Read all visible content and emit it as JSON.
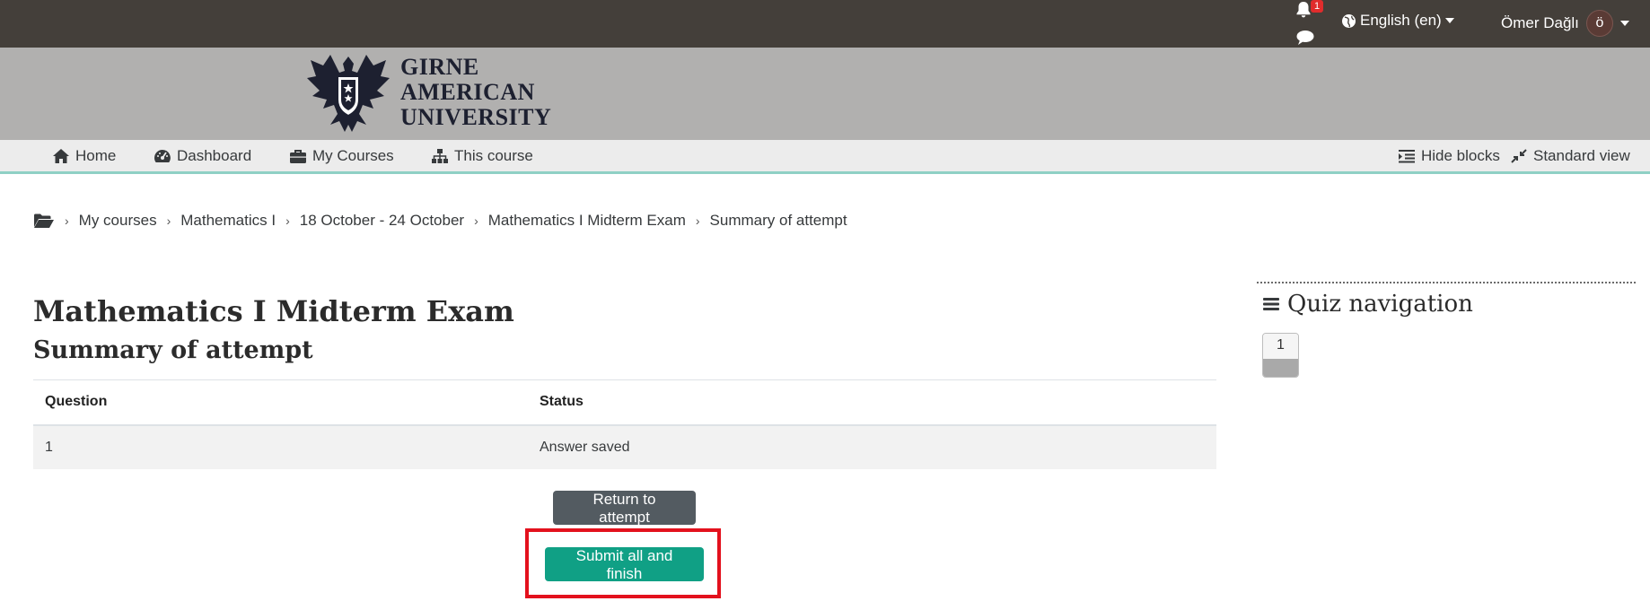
{
  "topbar": {
    "notifications_count": "1",
    "language_label": "English (en)",
    "user_name": "Ömer Dağlı",
    "avatar_initial": "ö"
  },
  "banner": {
    "logo_line1": "GIRNE",
    "logo_line2": "AMERICAN",
    "logo_line3": "UNIVERSITY"
  },
  "nav": {
    "home": "Home",
    "dashboard": "Dashboard",
    "my_courses": "My Courses",
    "this_course": "This course",
    "hide_blocks": "Hide blocks",
    "standard_view": "Standard view"
  },
  "breadcrumb": {
    "items": [
      "My courses",
      "Mathematics I",
      "18 October - 24 October",
      "Mathematics I Midterm Exam",
      "Summary of attempt"
    ]
  },
  "main": {
    "title": "Mathematics I Midterm Exam",
    "subtitle": "Summary of attempt",
    "table": {
      "headers": [
        "Question",
        "Status"
      ],
      "rows": [
        [
          "1",
          "Answer saved"
        ]
      ]
    },
    "return_button": "Return to attempt",
    "submit_button": "Submit all and finish"
  },
  "quiz_nav": {
    "title": "Quiz navigation",
    "questions": [
      "1"
    ]
  },
  "colors": {
    "topbar": "#443f3a",
    "banner": "#b1b0af",
    "accent": "#10a085",
    "highlight": "#e3111d"
  }
}
